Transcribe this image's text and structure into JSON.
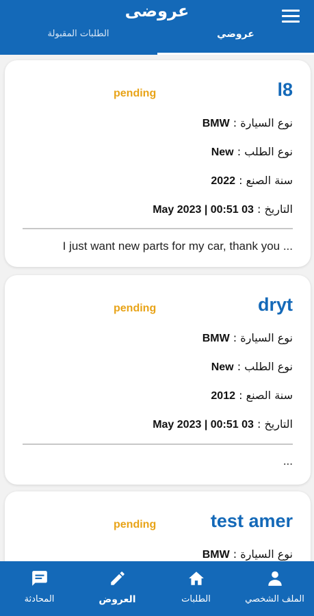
{
  "appbar": {
    "title": "عروضى",
    "tabs": [
      {
        "label": "عروضي"
      },
      {
        "label": "الطلبات المقبولة"
      }
    ]
  },
  "labels": {
    "car_type": "نوع السيارة : ",
    "order_type": "نوع الطلب : ",
    "year": "سنة الصنع : ",
    "date": "التاريخ : "
  },
  "offers": [
    {
      "name": "l8",
      "status": "pending",
      "car_type": "BMW",
      "order_type": "New",
      "year": "2022",
      "date": "03 May 2023 | 00:51",
      "description": "I just want new parts for my car, thank you ..."
    },
    {
      "name": "dryt",
      "status": "pending",
      "car_type": "BMW",
      "order_type": "New",
      "year": "2012",
      "date": "03 May 2023 | 00:51",
      "description": "..."
    },
    {
      "name": "test amer",
      "status": "pending",
      "car_type": "BMW",
      "order_type": "",
      "year": "",
      "date": "",
      "description": ""
    }
  ],
  "bottom_nav": [
    {
      "label": "الملف الشخصي",
      "icon": "person-icon"
    },
    {
      "label": "الطلبات",
      "icon": "home-icon"
    },
    {
      "label": "العروض",
      "icon": "edit-icon"
    },
    {
      "label": "المحادثة",
      "icon": "chat-icon"
    }
  ],
  "colors": {
    "primary": "#1469b8",
    "pending": "#e8a317"
  }
}
